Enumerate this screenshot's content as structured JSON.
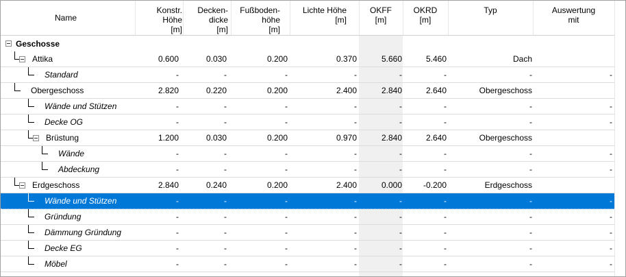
{
  "header": {
    "name": "Name",
    "konstr_hoehe": "Konstr.\nHöhe\n[m]",
    "deckendicke": "Decken-\ndicke\n[m]",
    "fussbodenhoehe": "Fußboden-\nhöhe\n[m]",
    "lichte_hoehe": "Lichte Höhe\n[m]",
    "okff": "OKFF\n[m]",
    "okrd": "OKRD\n[m]",
    "typ": "Typ",
    "auswertung": "Auswertung\nmit"
  },
  "group": {
    "label": "Geschosse"
  },
  "rows": [
    {
      "name": "Attika",
      "konstr": "0.600",
      "decke": "0.030",
      "fuss": "0.200",
      "lichte": "0.370",
      "okff": "5.660",
      "okrd": "5.460",
      "typ": "Dach",
      "ausw": ""
    },
    {
      "name": "Standard",
      "konstr": "-",
      "decke": "-",
      "fuss": "-",
      "lichte": "-",
      "okff": "-",
      "okrd": "-",
      "typ": "-",
      "ausw": "-"
    },
    {
      "name": "Obergeschoss",
      "konstr": "2.820",
      "decke": "0.220",
      "fuss": "0.200",
      "lichte": "2.400",
      "okff": "2.840",
      "okrd": "2.640",
      "typ": "Obergeschoss",
      "ausw": ""
    },
    {
      "name": "Wände und Stützen",
      "konstr": "-",
      "decke": "-",
      "fuss": "-",
      "lichte": "-",
      "okff": "-",
      "okrd": "-",
      "typ": "-",
      "ausw": "-"
    },
    {
      "name": "Decke OG",
      "konstr": "-",
      "decke": "-",
      "fuss": "-",
      "lichte": "-",
      "okff": "-",
      "okrd": "-",
      "typ": "-",
      "ausw": "-"
    },
    {
      "name": "Brüstung",
      "konstr": "1.200",
      "decke": "0.030",
      "fuss": "0.200",
      "lichte": "0.970",
      "okff": "2.840",
      "okrd": "2.640",
      "typ": "Obergeschoss",
      "ausw": ""
    },
    {
      "name": "Wände",
      "konstr": "-",
      "decke": "-",
      "fuss": "-",
      "lichte": "-",
      "okff": "-",
      "okrd": "-",
      "typ": "-",
      "ausw": "-"
    },
    {
      "name": "Abdeckung",
      "konstr": "-",
      "decke": "-",
      "fuss": "-",
      "lichte": "-",
      "okff": "-",
      "okrd": "-",
      "typ": "-",
      "ausw": "-"
    },
    {
      "name": "Erdgeschoss",
      "konstr": "2.840",
      "decke": "0.240",
      "fuss": "0.200",
      "lichte": "2.400",
      "okff": "0.000",
      "okrd": "-0.200",
      "typ": "Erdgeschoss",
      "ausw": ""
    },
    {
      "name": "Wände und Stützen",
      "konstr": "-",
      "decke": "-",
      "fuss": "-",
      "lichte": "-",
      "okff": "-",
      "okrd": "-",
      "typ": "-",
      "ausw": "-"
    },
    {
      "name": "Gründung",
      "konstr": "-",
      "decke": "-",
      "fuss": "-",
      "lichte": "-",
      "okff": "-",
      "okrd": "-",
      "typ": "-",
      "ausw": "-"
    },
    {
      "name": "Dämmung Gründung",
      "konstr": "-",
      "decke": "-",
      "fuss": "-",
      "lichte": "-",
      "okff": "-",
      "okrd": "-",
      "typ": "-",
      "ausw": "-"
    },
    {
      "name": "Decke EG",
      "konstr": "-",
      "decke": "-",
      "fuss": "-",
      "lichte": "-",
      "okff": "-",
      "okrd": "-",
      "typ": "-",
      "ausw": "-"
    },
    {
      "name": "Möbel",
      "konstr": "-",
      "decke": "-",
      "fuss": "-",
      "lichte": "-",
      "okff": "-",
      "okrd": "-",
      "typ": "-",
      "ausw": "-"
    }
  ],
  "selected_row_index": 9,
  "colors": {
    "selection": "#0078d7",
    "okff_band": "#f0f0f0"
  }
}
